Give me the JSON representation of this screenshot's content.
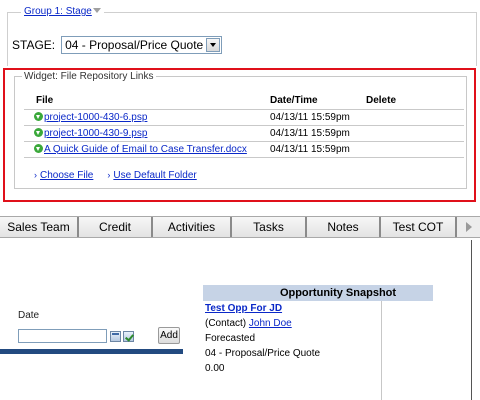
{
  "group": {
    "legend": "Group 1: Stage",
    "stage_label": "STAGE:",
    "stage_value": "04 - Proposal/Price Quote"
  },
  "widget": {
    "legend": "Widget: File Repository Links",
    "headers": {
      "file": "File",
      "datetime": "Date/Time",
      "delete": "Delete"
    },
    "files": [
      {
        "name": "project-1000-430-6.psp",
        "datetime": "04/13/11 15:59pm"
      },
      {
        "name": "project-1000-430-9.psp",
        "datetime": "04/13/11 15:59pm"
      },
      {
        "name": "A Quick Guide of Email to Case Transfer.docx",
        "datetime": "04/13/11 15:59pm"
      }
    ],
    "choose_file": "Choose File",
    "default_folder": "Use Default Folder",
    "bullet": "›"
  },
  "tabs": [
    {
      "label": "Sales Team"
    },
    {
      "label": "Credit"
    },
    {
      "label": "Activities"
    },
    {
      "label": "Tasks"
    },
    {
      "label": "Notes"
    },
    {
      "label": "Test COT"
    }
  ],
  "form": {
    "date_label": "Date",
    "date_value": "",
    "add_label": "Add"
  },
  "snapshot": {
    "header": "Opportunity Snapshot",
    "opp_name": "Test Opp For JD",
    "contact_prefix": "(Contact) ",
    "contact_name": "John Doe",
    "forecast": "Forecasted",
    "stage": "04 - Proposal/Price Quote",
    "amount": "0.00"
  },
  "colors": {
    "highlight": "#e0101a",
    "link": "#0a28c8",
    "snapshot_header": "#c6d3e6",
    "blue_bar": "#224a80"
  },
  "icons": {
    "legend_toggle": "chevron-down-icon",
    "file_row": "green-download-arrow-icon",
    "calendar": "calendar-icon",
    "check": "checkmark-icon",
    "tab_scroll": "arrow-right-icon"
  }
}
